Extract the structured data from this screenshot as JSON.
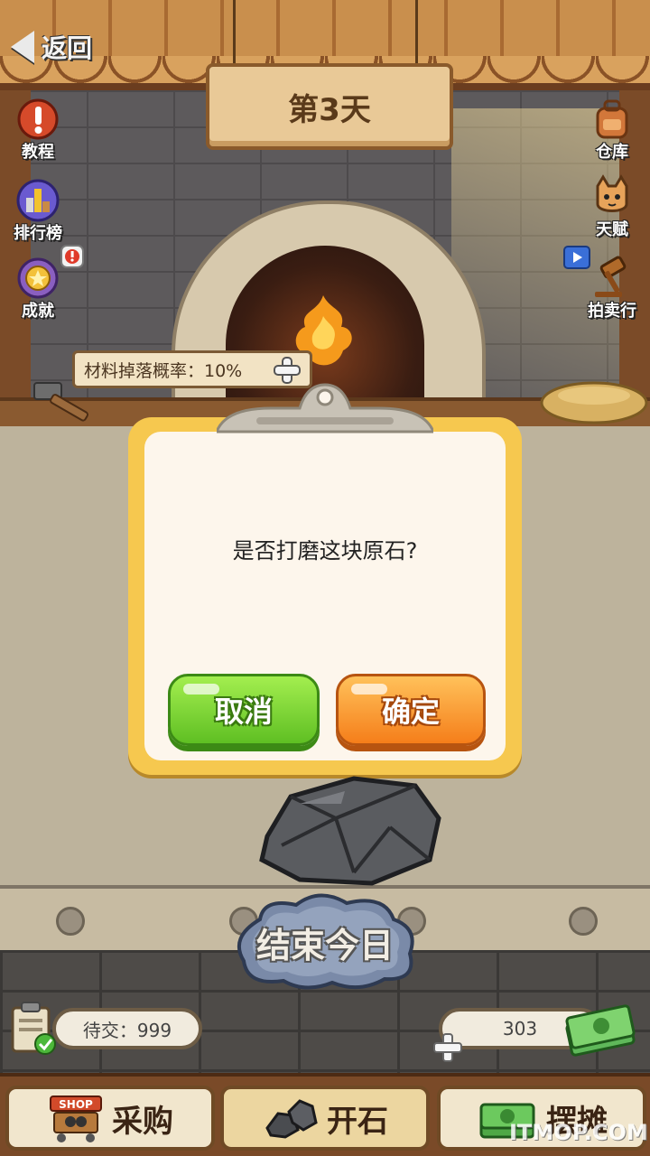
{
  "header": {
    "back_label": "返回",
    "day_title": "第3天"
  },
  "left_menu": [
    {
      "label": "教程",
      "icon": "exclamation-icon"
    },
    {
      "label": "排行榜",
      "icon": "trophy-ranking-icon"
    },
    {
      "label": "成就",
      "icon": "medal-icon"
    }
  ],
  "right_menu": [
    {
      "label": "仓库",
      "icon": "backpack-icon"
    },
    {
      "label": "天赋",
      "icon": "cat-icon"
    },
    {
      "label": "拍卖行",
      "icon": "gavel-icon"
    }
  ],
  "drop_rate": {
    "label": "材料掉落概率：10%"
  },
  "dialog": {
    "message": "是否打磨这块原石?",
    "cancel_label": "取消",
    "confirm_label": "确定"
  },
  "end_day_label": "结束今日",
  "status": {
    "pending_label": "待交：999",
    "money_value": "303"
  },
  "bottom_tabs": [
    {
      "label": "采购",
      "icon": "shop-cart-icon",
      "badge": "SHOP",
      "active": false
    },
    {
      "label": "开石",
      "icon": "stones-icon",
      "active": true
    },
    {
      "label": "摆摊",
      "icon": "money-stack-icon",
      "active": false
    }
  ],
  "watermark": "ITMOP.COM",
  "colors": {
    "dialog_border": "#f6c84f",
    "cancel_green": "#5fbf23",
    "confirm_orange": "#f57e1a"
  }
}
